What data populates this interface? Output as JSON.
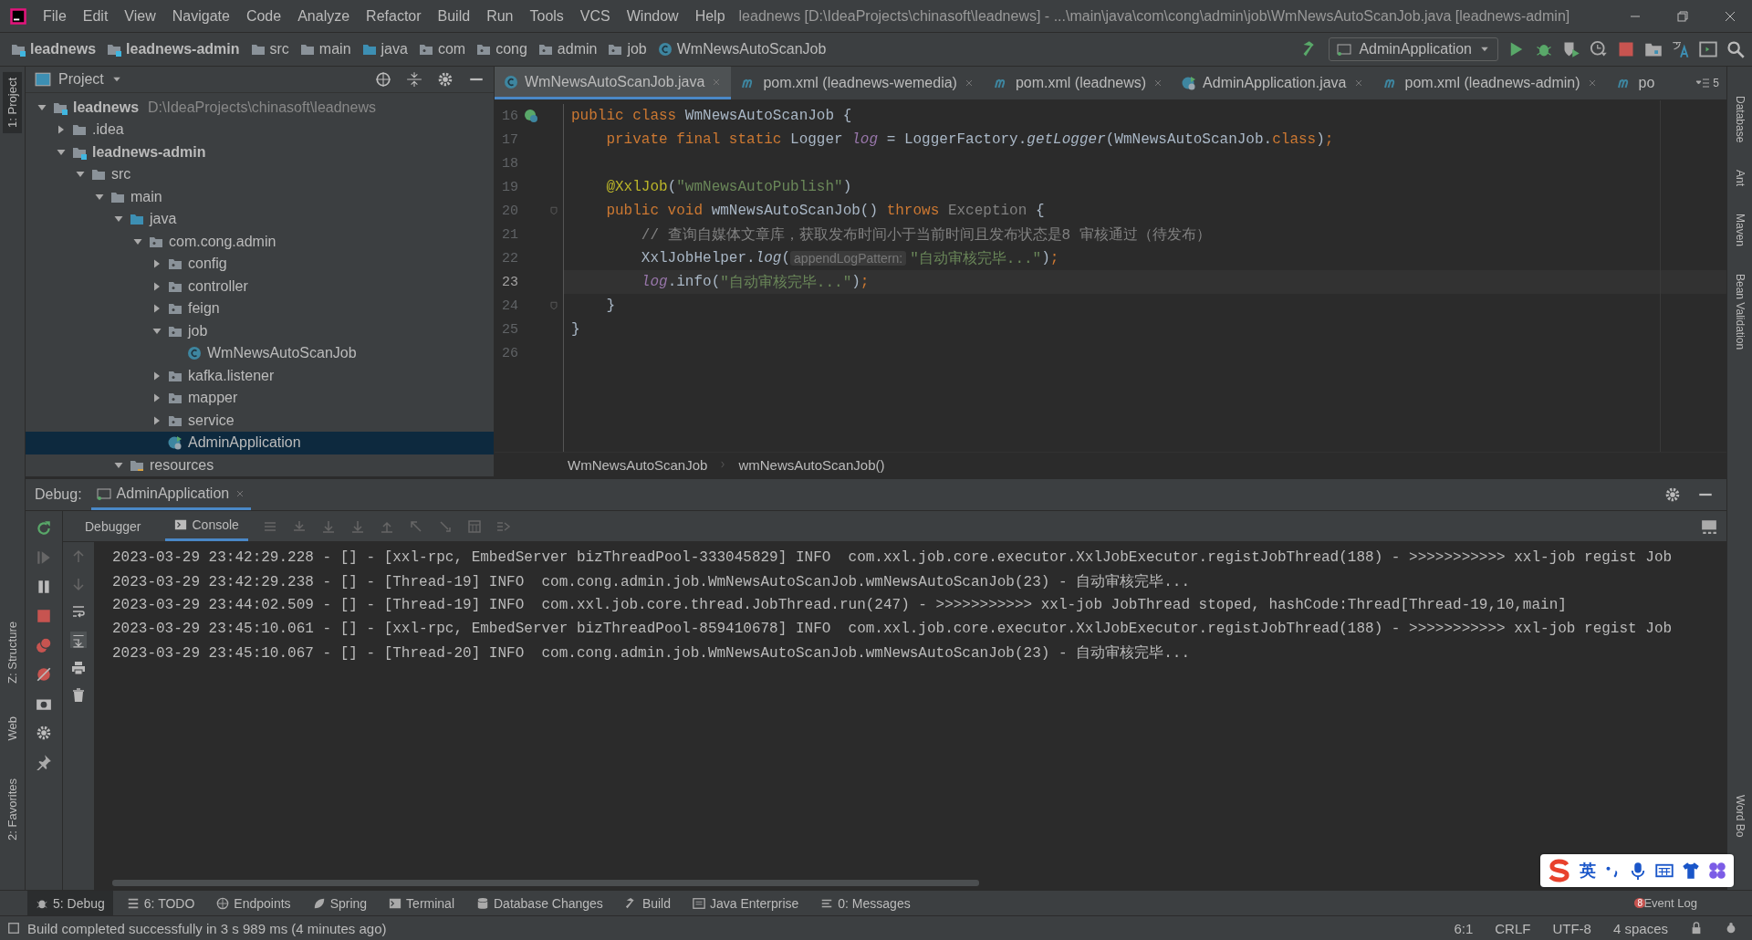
{
  "window": {
    "title": "leadnews [D:\\IdeaProjects\\chinasoft\\leadnews] - ...\\main\\java\\com\\cong\\admin\\job\\WmNewsAutoScanJob.java [leadnews-admin]"
  },
  "menu": [
    "File",
    "Edit",
    "View",
    "Navigate",
    "Code",
    "Analyze",
    "Refactor",
    "Build",
    "Run",
    "Tools",
    "VCS",
    "Window",
    "Help"
  ],
  "breadcrumbs": [
    {
      "label": "leadnews",
      "kind": "module"
    },
    {
      "label": "leadnews-admin",
      "kind": "module"
    },
    {
      "label": "src",
      "kind": "folder"
    },
    {
      "label": "main",
      "kind": "folder"
    },
    {
      "label": "java",
      "kind": "source"
    },
    {
      "label": "com",
      "kind": "package"
    },
    {
      "label": "cong",
      "kind": "package"
    },
    {
      "label": "admin",
      "kind": "package"
    },
    {
      "label": "job",
      "kind": "package"
    },
    {
      "label": "WmNewsAutoScanJob",
      "kind": "class"
    }
  ],
  "run_config": "AdminApplication",
  "left_strip": [
    {
      "label": "1: Project",
      "selected": true
    },
    {
      "label": "Z: Structure",
      "selected": false
    },
    {
      "label": "Web",
      "selected": false
    },
    {
      "label": "2: Favorites",
      "selected": false
    }
  ],
  "right_strip": [
    "Database",
    "Ant",
    "Maven",
    "Bean Validation",
    "Word Bo"
  ],
  "project_panel": {
    "title": "Project",
    "tree": [
      {
        "label": "leadnews",
        "kind": "module",
        "path": "D:\\IdeaProjects\\chinasoft\\leadnews",
        "expanded": true,
        "selected": false,
        "children": [
          {
            "label": ".idea",
            "kind": "folder",
            "expanded": false,
            "selected": false
          },
          {
            "label": "leadnews-admin",
            "kind": "module",
            "expanded": true,
            "selected": false,
            "children": [
              {
                "label": "src",
                "kind": "folder",
                "expanded": true,
                "selected": false,
                "children": [
                  {
                    "label": "main",
                    "kind": "folder",
                    "expanded": true,
                    "selected": false,
                    "children": [
                      {
                        "label": "java",
                        "kind": "source",
                        "expanded": true,
                        "selected": false,
                        "children": [
                          {
                            "label": "com.cong.admin",
                            "kind": "package",
                            "expanded": true,
                            "selected": false,
                            "children": [
                              {
                                "label": "config",
                                "kind": "package",
                                "expanded": false,
                                "selected": false
                              },
                              {
                                "label": "controller",
                                "kind": "package",
                                "expanded": false,
                                "selected": false
                              },
                              {
                                "label": "feign",
                                "kind": "package",
                                "expanded": false,
                                "selected": false
                              },
                              {
                                "label": "job",
                                "kind": "package",
                                "expanded": true,
                                "selected": false,
                                "children": [
                                  {
                                    "label": "WmNewsAutoScanJob",
                                    "kind": "class",
                                    "selected": false
                                  }
                                ]
                              },
                              {
                                "label": "kafka.listener",
                                "kind": "package",
                                "expanded": false,
                                "selected": false
                              },
                              {
                                "label": "mapper",
                                "kind": "package",
                                "expanded": false,
                                "selected": false
                              },
                              {
                                "label": "service",
                                "kind": "package",
                                "expanded": false,
                                "selected": false
                              },
                              {
                                "label": "AdminApplication",
                                "kind": "app",
                                "selected": true
                              }
                            ]
                          }
                        ]
                      },
                      {
                        "label": "resources",
                        "kind": "resources",
                        "expanded": true,
                        "selected": false
                      }
                    ]
                  }
                ]
              }
            ]
          }
        ]
      }
    ]
  },
  "editor_tabs": [
    {
      "label": "WmNewsAutoScanJob.java",
      "kind": "class",
      "selected": true
    },
    {
      "label": "pom.xml (leadnews-wemedia)",
      "kind": "maven",
      "selected": false
    },
    {
      "label": "pom.xml (leadnews)",
      "kind": "maven",
      "selected": false
    },
    {
      "label": "AdminApplication.java",
      "kind": "app",
      "selected": false
    },
    {
      "label": "pom.xml (leadnews-admin)",
      "kind": "maven",
      "selected": false
    },
    {
      "label": "po",
      "kind": "maven",
      "selected": false
    }
  ],
  "tab_overflow_count": "5",
  "code": [
    {
      "number": "16",
      "current": false,
      "kind": "bean",
      "tokens": [
        {
          "text": "public class ",
          "kind": "keyword"
        },
        {
          "text": "WmNewsAutoScanJob {",
          "kind": "plain"
        }
      ]
    },
    {
      "number": "17",
      "current": false,
      "tokens": [
        {
          "text": "    private final static ",
          "kind": "keyword"
        },
        {
          "text": "Logger ",
          "kind": "plain"
        },
        {
          "text": "log",
          "kind": "field"
        },
        {
          "text": " = LoggerFactory.",
          "kind": "plain"
        },
        {
          "text": "getLogger",
          "kind": "method"
        },
        {
          "text": "(WmNewsAutoScanJob.",
          "kind": "plain"
        },
        {
          "text": "class",
          "kind": "keyword"
        },
        {
          "text": ")",
          "kind": "plain"
        },
        {
          "text": ";",
          "kind": "keyword"
        }
      ]
    },
    {
      "number": "18",
      "current": false
    },
    {
      "number": "19",
      "current": false,
      "tokens": [
        {
          "text": "    @XxlJob",
          "kind": "annotation"
        },
        {
          "text": "(",
          "kind": "plain"
        },
        {
          "text": "\"wmNewsAutoPublish\"",
          "kind": "string"
        },
        {
          "text": ")",
          "kind": "plain"
        }
      ]
    },
    {
      "number": "20",
      "current": false,
      "kind": "fold",
      "tokens": [
        {
          "text": "    public void ",
          "kind": "keyword"
        },
        {
          "text": "wmNewsAutoScanJob() ",
          "kind": "plain"
        },
        {
          "text": "throws ",
          "kind": "keyword"
        },
        {
          "text": "Exception",
          "kind": "unused"
        },
        {
          "text": " {",
          "kind": "plain"
        }
      ]
    },
    {
      "number": "21",
      "current": false,
      "tokens": [
        {
          "text": "        // 查询自媒体文章库，获取发布时间小于当前时间且发布状态是8 审核通过（待发布）",
          "kind": "comment"
        }
      ]
    },
    {
      "number": "22",
      "current": false,
      "tokens": [
        {
          "text": "        XxlJobHelper.",
          "kind": "plain"
        },
        {
          "text": "log",
          "kind": "method"
        },
        {
          "text": "(",
          "kind": "plain"
        },
        {
          "text": "appendLogPattern:",
          "kind": "hint"
        },
        {
          "text": "\"自动审核完毕...\"",
          "kind": "string"
        },
        {
          "text": ")",
          "kind": "plain"
        },
        {
          "text": ";",
          "kind": "keyword"
        }
      ]
    },
    {
      "number": "23",
      "current": true,
      "tokens": [
        {
          "text": "        log",
          "kind": "field"
        },
        {
          "text": ".info(",
          "kind": "plain"
        },
        {
          "text": "\"自动审核完毕...\"",
          "kind": "string"
        },
        {
          "text": ")",
          "kind": "plain"
        },
        {
          "text": ";",
          "kind": "keyword"
        }
      ]
    },
    {
      "number": "24",
      "current": false,
      "kind": "fold",
      "tokens": [
        {
          "text": "    }",
          "kind": "plain"
        }
      ]
    },
    {
      "number": "25",
      "current": false,
      "tokens": [
        {
          "text": "}",
          "kind": "plain"
        }
      ]
    },
    {
      "number": "26",
      "current": false
    }
  ],
  "editor_breadcrumbs": [
    "WmNewsAutoScanJob",
    "wmNewsAutoScanJob()"
  ],
  "debug": {
    "label": "Debug:",
    "session": "AdminApplication",
    "tabs": [
      {
        "label": "Debugger",
        "selected": false
      },
      {
        "label": "Console",
        "selected": true
      }
    ],
    "console": [
      "2023-03-29 23:42:29.228 - [] - [xxl-rpc, EmbedServer bizThreadPool-333045829] INFO  com.xxl.job.core.executor.XxlJobExecutor.registJobThread(188) - >>>>>>>>>>> xxl-job regist Job",
      "2023-03-29 23:42:29.238 - [] - [Thread-19] INFO  com.cong.admin.job.WmNewsAutoScanJob.wmNewsAutoScanJob(23) - 自动审核完毕...",
      "2023-03-29 23:44:02.509 - [] - [Thread-19] INFO  com.xxl.job.core.thread.JobThread.run(247) - >>>>>>>>>>> xxl-job JobThread stoped, hashCode:Thread[Thread-19,10,main]",
      "2023-03-29 23:45:10.061 - [] - [xxl-rpc, EmbedServer bizThreadPool-859410678] INFO  com.xxl.job.core.executor.XxlJobExecutor.registJobThread(188) - >>>>>>>>>>> xxl-job regist Job",
      "2023-03-29 23:45:10.067 - [] - [Thread-20] INFO  com.cong.admin.job.WmNewsAutoScanJob.wmNewsAutoScanJob(23) - 自动审核完毕..."
    ]
  },
  "tool_windows": [
    {
      "label": "5: Debug",
      "kind": "debug",
      "selected": true
    },
    {
      "label": "6: TODO",
      "kind": "todo",
      "selected": false
    },
    {
      "label": "Endpoints",
      "kind": "endpoints",
      "selected": false
    },
    {
      "label": "Spring",
      "kind": "spring",
      "selected": false
    },
    {
      "label": "Terminal",
      "kind": "terminal",
      "selected": false
    },
    {
      "label": "Database Changes",
      "kind": "database",
      "selected": false
    },
    {
      "label": "Build",
      "kind": "build",
      "selected": false
    },
    {
      "label": "Java Enterprise",
      "kind": "enterprise",
      "selected": false
    },
    {
      "label": "0: Messages",
      "kind": "messages",
      "selected": false
    }
  ],
  "event_log": {
    "label": "Event Log",
    "count": "8"
  },
  "ime_bar": {
    "mode": "英"
  },
  "status_bar": {
    "message": "Build completed successfully in 3 s 989 ms (4 minutes ago)",
    "position": "6:1",
    "line_separator": "CRLF",
    "encoding": "UTF-8",
    "indent": "4 spaces"
  }
}
